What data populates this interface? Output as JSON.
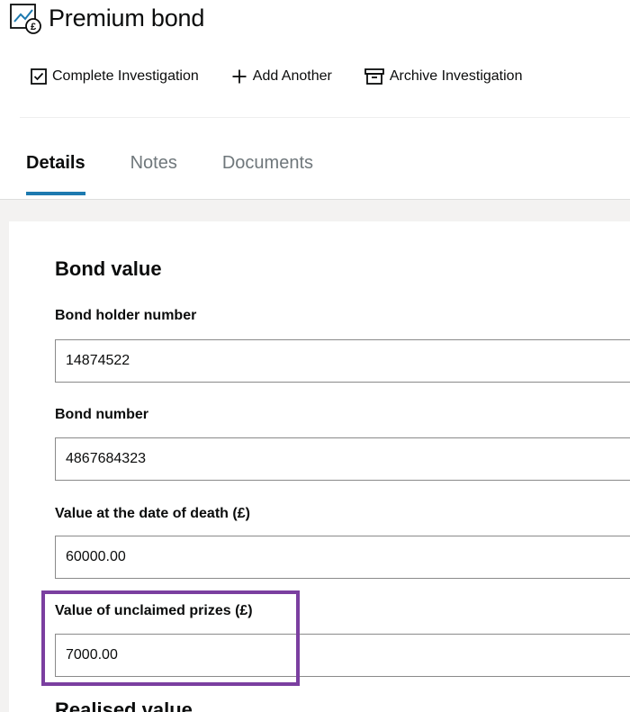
{
  "page": {
    "title": "Premium bond",
    "title_icon": "chart-pound-icon"
  },
  "actions": [
    {
      "label": "Complete Investigation",
      "icon": "checkbox-icon"
    },
    {
      "label": "Add Another",
      "icon": "plus-icon"
    },
    {
      "label": "Archive Investigation",
      "icon": "archive-icon"
    }
  ],
  "tabs": [
    {
      "label": "Details",
      "active": true
    },
    {
      "label": "Notes",
      "active": false
    },
    {
      "label": "Documents",
      "active": false
    }
  ],
  "section": {
    "title": "Bond value",
    "fields": {
      "bond_holder_number": {
        "label": "Bond holder number",
        "value": "14874522"
      },
      "bond_number": {
        "label": "Bond number",
        "value": "4867684323"
      },
      "value_at_death": {
        "label": "Value at the date of death (£)",
        "value": "60000.00"
      },
      "unclaimed_prizes": {
        "label": "Value of unclaimed prizes (£)",
        "value": "7000.00"
      }
    }
  },
  "next_section": {
    "title": "Realised value"
  },
  "colors": {
    "accent": "#1d7ab0",
    "highlight": "#7b3fa0",
    "background": "#f3f2f1",
    "inactive_tab": "#6f777b"
  }
}
